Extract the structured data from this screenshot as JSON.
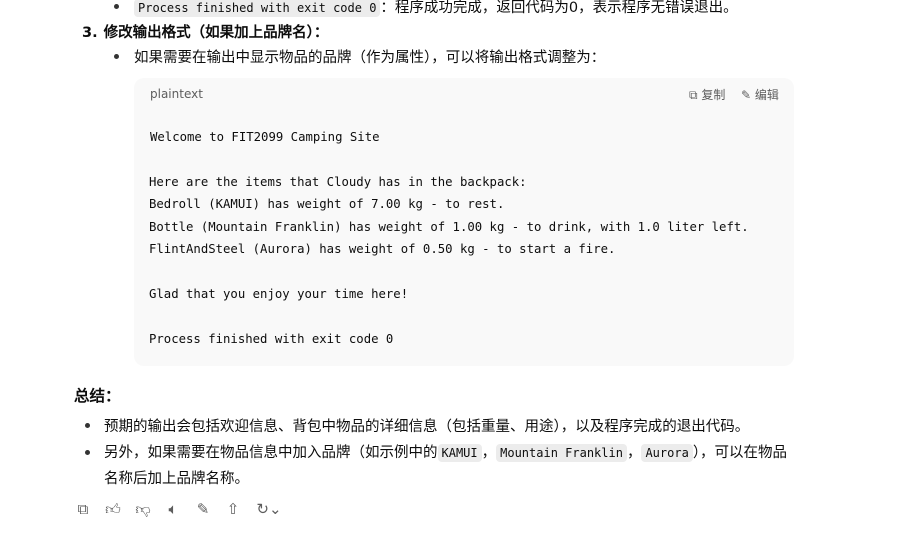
{
  "top_item": {
    "code": "Process finished with exit code 0",
    "text": "：程序成功完成，返回代码为0，表示程序无错误退出。"
  },
  "step3": {
    "number": "3.",
    "title": "修改输出格式（如果加上品牌名）",
    "colon": "：",
    "bullet": "如果需要在输出中显示物品的品牌（作为属性），可以将输出格式调整为："
  },
  "code_block": {
    "language": "plaintext",
    "copy_label": "复制",
    "edit_label": "编辑",
    "lines": [
      "Welcome to FIT2099 Camping Site",
      "Here are the items that Cloudy has in the backpack:",
      "Bedroll (KAMUI) has weight of 7.00 kg - to rest.",
      "Bottle (Mountain Franklin) has weight of 1.00 kg - to drink, with 1.0 liter left.",
      "FlintAndSteel (Aurora) has weight of 0.50 kg - to start a fire.",
      "Glad that you enjoy your time here!",
      "Process finished with exit code 0"
    ]
  },
  "summary": {
    "heading": "总结：",
    "items": [
      {
        "text": "预期的输出会包括欢迎信息、背包中物品的详细信息（包括重量、用途），以及程序完成的退出代码。"
      },
      {
        "pre": "另外，如果需要在物品信息中加入品牌（如示例中的",
        "codes": [
          "KAMUI",
          "Mountain Franklin",
          "Aurora"
        ],
        "sep": "，",
        "post": "），可以在物品",
        "post2": "名称后加上品牌名称。"
      }
    ]
  },
  "actions": [
    "copy-icon",
    "thumbs-up-icon",
    "thumbs-down-icon",
    "read-aloud-icon",
    "edit-icon",
    "share-icon",
    "regenerate-icon"
  ]
}
